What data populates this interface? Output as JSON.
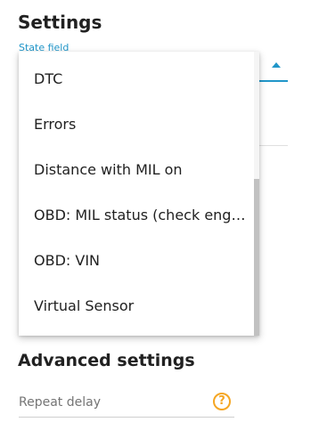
{
  "header": {
    "title": "Settings"
  },
  "state_field": {
    "label": "State field"
  },
  "dropdown": {
    "options": [
      "DTC",
      "Errors",
      "Distance with MIL on",
      "OBD: MIL status (check engi...",
      "OBD: VIN",
      "Virtual Sensor"
    ]
  },
  "advanced": {
    "title": "Advanced settings",
    "repeat_delay_label": "Repeat delay",
    "help_symbol": "?"
  },
  "colors": {
    "accent": "#2196c9",
    "help": "#f5a623"
  },
  "icons": {
    "dropdown_arrow": "caret-up-icon",
    "help": "help-circle-icon"
  }
}
